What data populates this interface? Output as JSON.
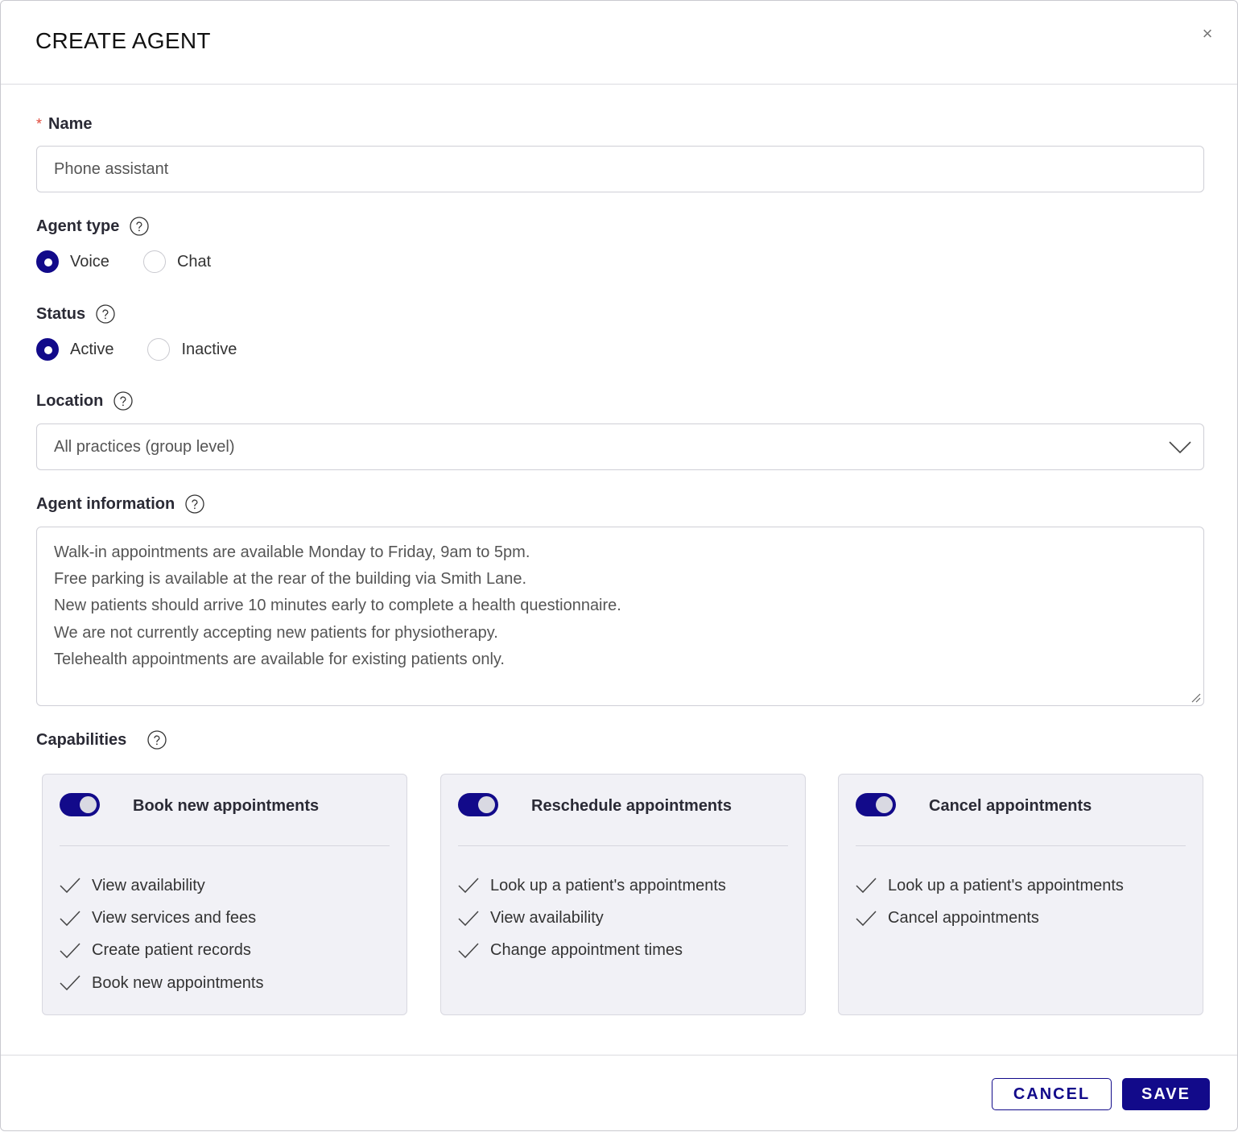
{
  "dialog": {
    "title": "CREATE AGENT",
    "close_glyph": "×"
  },
  "name_field": {
    "label": "Name",
    "required_marker": "*",
    "value": "Phone assistant"
  },
  "agent_type": {
    "label": "Agent type",
    "options": [
      {
        "label": "Voice",
        "selected": true
      },
      {
        "label": "Chat",
        "selected": false
      }
    ]
  },
  "status": {
    "label": "Status",
    "options": [
      {
        "label": "Active",
        "selected": true
      },
      {
        "label": "Inactive",
        "selected": false
      }
    ]
  },
  "location": {
    "label": "Location",
    "selected": "All practices (group level)"
  },
  "agent_information": {
    "label": "Agent information",
    "lines": [
      "Walk-in appointments are available Monday to Friday, 9am to 5pm.",
      "Free parking is available at the rear of the building via Smith Lane.",
      "New patients should arrive 10 minutes early to complete a health questionnaire.",
      "We are not currently accepting new patients for physiotherapy.",
      "Telehealth appointments are available for existing patients only."
    ]
  },
  "capabilities": {
    "label": "Capabilities",
    "cards": [
      {
        "title": "Book new appointments",
        "enabled": true,
        "items": [
          "View availability",
          "View services and fees",
          "Create patient records",
          "Book new appointments"
        ]
      },
      {
        "title": "Reschedule appointments",
        "enabled": true,
        "items": [
          "Look up a patient's appointments",
          "View availability",
          "Change appointment times"
        ]
      },
      {
        "title": "Cancel appointments",
        "enabled": true,
        "items": [
          "Look up a patient's appointments",
          "Cancel appointments"
        ]
      }
    ]
  },
  "footer": {
    "cancel_label": "CANCEL",
    "save_label": "SAVE"
  },
  "colors": {
    "primary": "#120a8a",
    "required": "#e0493c",
    "card_bg": "#f1f1f6"
  },
  "icons": {
    "help": "question-circle-icon",
    "close": "close-icon",
    "dropdown": "chevron-down-icon",
    "check": "check-icon",
    "resize": "resize-handle-icon"
  }
}
